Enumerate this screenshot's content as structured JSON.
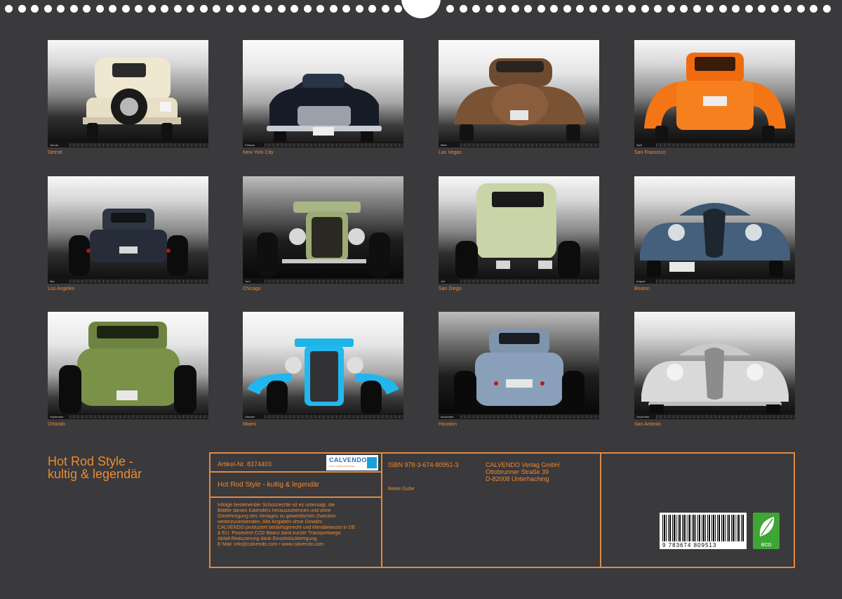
{
  "months": [
    {
      "name": "Januar",
      "city": "Detroit"
    },
    {
      "name": "Februar",
      "city": "New York City"
    },
    {
      "name": "März",
      "city": "Las Vegas"
    },
    {
      "name": "April",
      "city": "San Francisco"
    },
    {
      "name": "Mai",
      "city": "Los Angeles"
    },
    {
      "name": "Juni",
      "city": "Chicago"
    },
    {
      "name": "Juli",
      "city": "San Diego"
    },
    {
      "name": "August",
      "city": "Boston"
    },
    {
      "name": "September",
      "city": "Orlando"
    },
    {
      "name": "Oktober",
      "city": "Miami"
    },
    {
      "name": "November",
      "city": "Houston"
    },
    {
      "name": "Dezember",
      "city": "San Antonio"
    }
  ],
  "title": {
    "line1": "Hot Rod Style -",
    "line2": "kultig & legendär"
  },
  "info": {
    "artikel": "Artikel-Nr. 8374403",
    "logo_text": "CALVENDO",
    "logo_sub": "Kein Kalenderverlag",
    "product_title": "Hot Rod Style - kultig & legendär",
    "isbn": "ISBN 978-3-674-80951-3",
    "publisher": [
      "CALVENDO Verlag GmbH",
      "Ottobrunner Straße 39",
      "D-82008 Unterhaching"
    ],
    "author": "Beate Gube",
    "legal": [
      "Infolge bestehender Schutzrechte ist es untersagt, die",
      "Blätter dieses Kalenders herauszutrennen und ohne",
      "Genehmigung des Verlages zu gewerblichen Zwecken",
      "weiterzuverwenden. Alle Angaben ohne Gewähr.",
      "CALVENDO produziert bedarfsgerecht und klimabewusst in DE",
      "& EU. Positivere CO2-Bilanz dank kurzer Transportwege.",
      "Abfall-Reduzierung dank Einzelstückfertigung.",
      "E-Mail: info@calvendo.com • www.calvendo.com"
    ],
    "barcode_number": "9 783674 809513",
    "eco_label": "eco"
  },
  "colors": {
    "accent": "#f08a2e",
    "background": "#3a393c",
    "eco": "#3fa535"
  }
}
